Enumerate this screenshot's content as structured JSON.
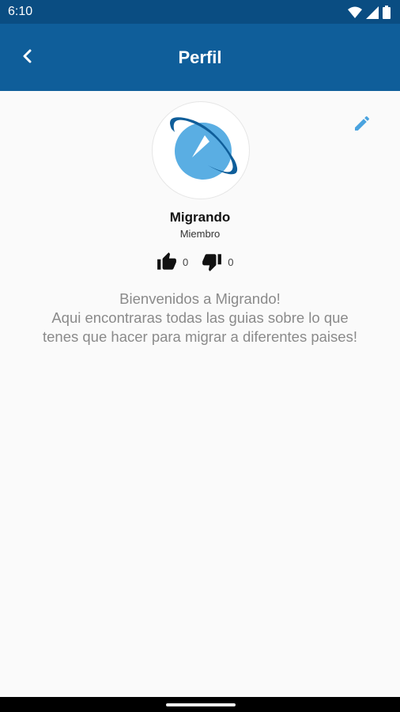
{
  "status_bar": {
    "time": "6:10",
    "icons": [
      "wifi-icon",
      "signal-icon",
      "battery-icon"
    ]
  },
  "header": {
    "title": "Perfil",
    "back_icon": "chevron-left-icon",
    "background": "#0f5e9a"
  },
  "profile": {
    "name": "Migrando",
    "role": "Miembro",
    "edit_icon": "pencil-icon",
    "likes": "0",
    "dislikes": "0"
  },
  "welcome": {
    "line1": "Bienvenidos a Migrando!",
    "line2": "Aqui encontraras todas las guias sobre lo que",
    "line3": "tenes que hacer para migrar a diferentes paises!"
  },
  "colors": {
    "accent": "#4aa3df",
    "status_bar": "#0a4d82",
    "text_muted": "#8a8a8a"
  }
}
